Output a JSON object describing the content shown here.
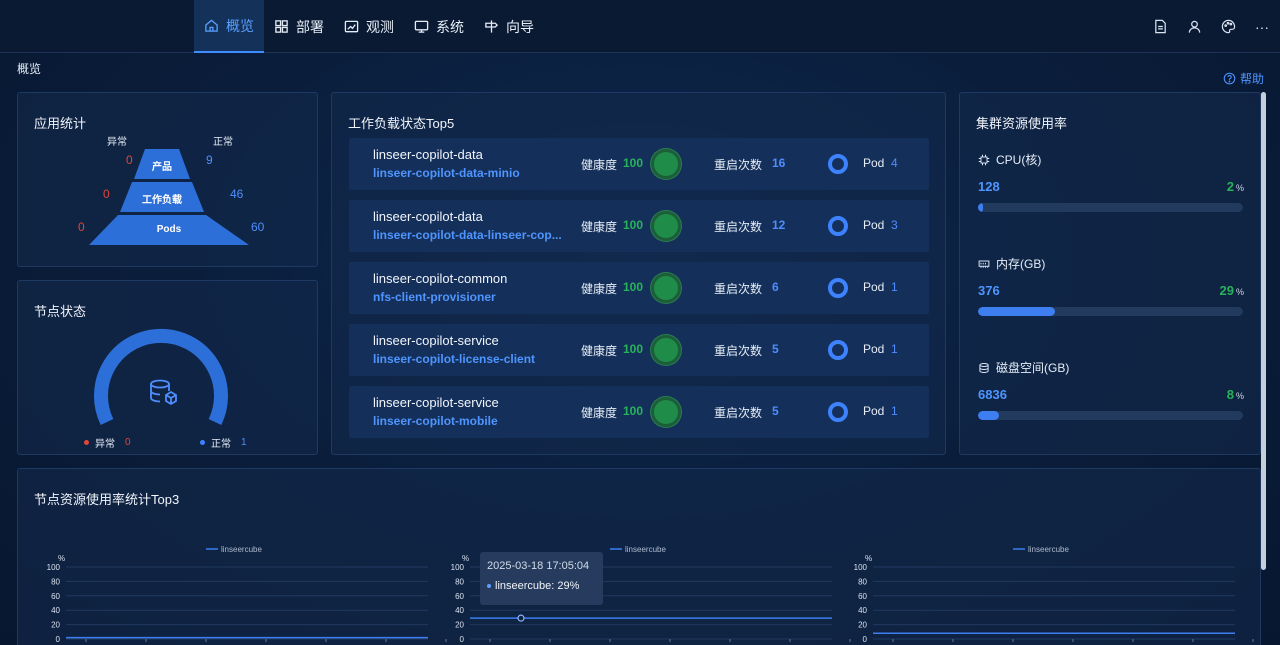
{
  "nav": {
    "items": [
      {
        "label": "概览",
        "icon": "home-icon",
        "active": true
      },
      {
        "label": "部署",
        "icon": "grid-icon",
        "active": false
      },
      {
        "label": "观测",
        "icon": "chart-icon",
        "active": false
      },
      {
        "label": "系统",
        "icon": "monitor-icon",
        "active": false
      },
      {
        "label": "向导",
        "icon": "guide-icon",
        "active": false
      }
    ],
    "tools": [
      "document-icon",
      "user-icon",
      "palette-icon",
      "more-icon"
    ]
  },
  "breadcrumb": "概览",
  "help_label": "帮助",
  "app_stats": {
    "title": "应用统计",
    "abnormal_label": "异常",
    "normal_label": "正常",
    "levels": [
      {
        "label": "产品",
        "abnormal": "0",
        "normal": "9"
      },
      {
        "label": "工作负载",
        "abnormal": "0",
        "normal": "46"
      },
      {
        "label": "Pods",
        "abnormal": "0",
        "normal": "60"
      }
    ]
  },
  "node_status": {
    "title": "节点状态",
    "abnormal_label": "异常",
    "abnormal": "0",
    "normal_label": "正常",
    "normal": "1",
    "normal_fraction": 1.0,
    "icon": "database-icon"
  },
  "workload": {
    "title": "工作负载状态Top5",
    "health_label": "健康度",
    "restart_label": "重启次数",
    "pod_label": "Pod",
    "rows": [
      {
        "namespace": "linseer-copilot-data",
        "name": "linseer-copilot-data-minio",
        "health": "100",
        "restarts": "16",
        "pods": "4"
      },
      {
        "namespace": "linseer-copilot-data",
        "name": "linseer-copilot-data-linseer-cop...",
        "health": "100",
        "restarts": "12",
        "pods": "3"
      },
      {
        "namespace": "linseer-copilot-common",
        "name": "nfs-client-provisioner",
        "health": "100",
        "restarts": "6",
        "pods": "1"
      },
      {
        "namespace": "linseer-copilot-service",
        "name": "linseer-copilot-license-client",
        "health": "100",
        "restarts": "5",
        "pods": "1"
      },
      {
        "namespace": "linseer-copilot-service",
        "name": "linseer-copilot-mobile",
        "health": "100",
        "restarts": "5",
        "pods": "1"
      }
    ]
  },
  "cluster": {
    "title": "集群资源使用率",
    "pct_unit": "%",
    "resources": [
      {
        "label": "CPU(核)",
        "icon": "cpu-icon",
        "value": "128",
        "percent": "2",
        "fraction": 0.02
      },
      {
        "label": "内存(GB)",
        "icon": "memory-icon",
        "value": "376",
        "percent": "29",
        "fraction": 0.29
      },
      {
        "label": "磁盘空间(GB)",
        "icon": "disk-icon",
        "value": "6836",
        "percent": "8",
        "fraction": 0.08
      }
    ]
  },
  "node_usage": {
    "title": "节点资源使用率统计Top3",
    "tooltip_time": "2025-03-18 17:05:04",
    "tooltip_value": "linseercube: 29%"
  },
  "chart_data": [
    {
      "type": "line",
      "ylabel": "%",
      "ylim": [
        0,
        100
      ],
      "yticks": [
        "100",
        "80",
        "60",
        "40",
        "20",
        "0"
      ],
      "legend": "top-center",
      "series": [
        {
          "name": "linseercube",
          "values": [
            2,
            2,
            2,
            2,
            2,
            2,
            2,
            2,
            2,
            2,
            2,
            2,
            2,
            2,
            2,
            2,
            2,
            2,
            2,
            2,
            2,
            2,
            2,
            2,
            2,
            2,
            2,
            2,
            2,
            2
          ]
        }
      ]
    },
    {
      "type": "line",
      "ylabel": "%",
      "ylim": [
        0,
        100
      ],
      "yticks": [
        "100",
        "80",
        "60",
        "40",
        "20",
        "0"
      ],
      "legend": "top-center",
      "series": [
        {
          "name": "linseercube",
          "values": [
            29,
            29,
            29,
            29,
            29,
            29,
            29,
            29,
            29,
            29,
            29,
            29,
            29,
            29,
            29,
            29,
            29,
            29,
            29,
            29,
            29,
            29,
            29,
            29,
            29,
            29,
            29,
            29,
            29,
            29
          ]
        }
      ]
    },
    {
      "type": "line",
      "ylabel": "%",
      "ylim": [
        0,
        100
      ],
      "yticks": [
        "100",
        "80",
        "60",
        "40",
        "20",
        "0"
      ],
      "legend": "top-center",
      "series": [
        {
          "name": "linseercube",
          "values": [
            8,
            8,
            8,
            8,
            8,
            8,
            8,
            8,
            8,
            8,
            8,
            8,
            8,
            8,
            8,
            8,
            8,
            8,
            8,
            8,
            8,
            8,
            8,
            8,
            8,
            8,
            8,
            8,
            8,
            8
          ]
        }
      ]
    }
  ],
  "colors": {
    "accent": "#3d8bff",
    "normal": "#27b35a",
    "abnormal": "#e0473a"
  }
}
